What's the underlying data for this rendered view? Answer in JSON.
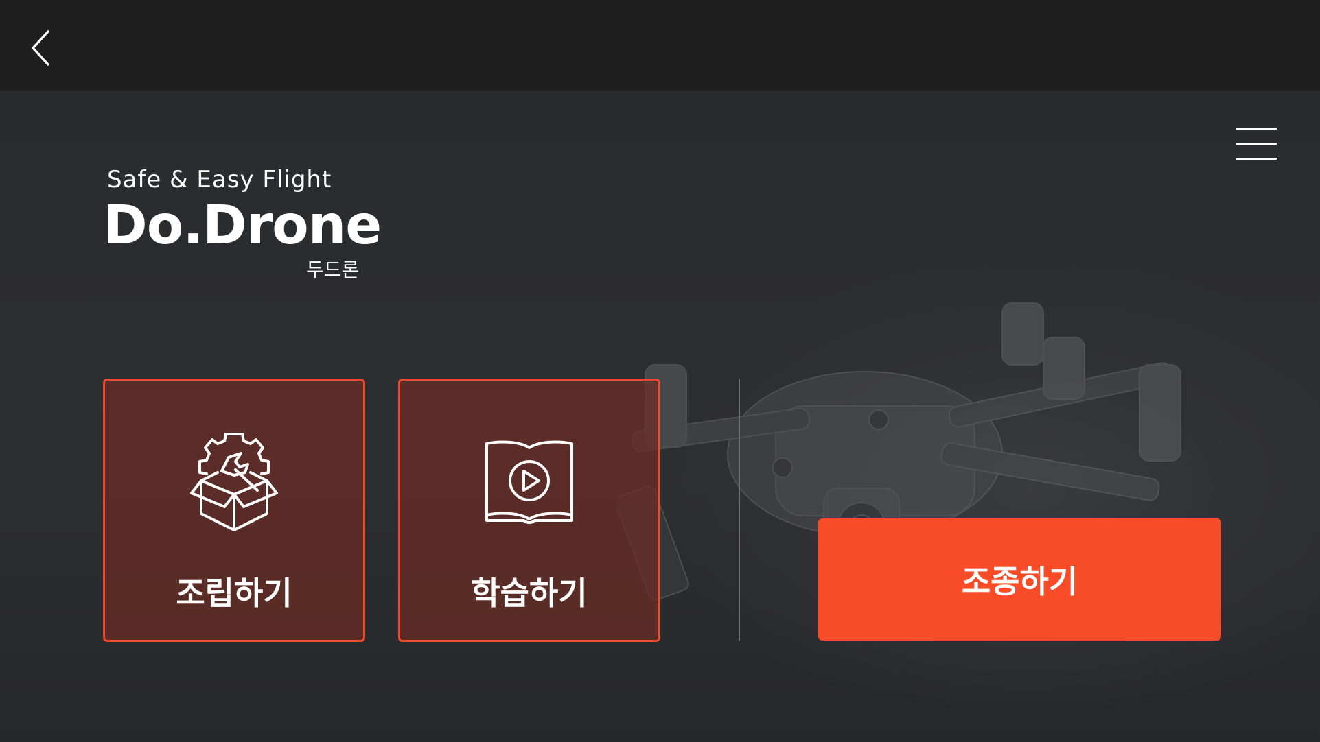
{
  "header": {
    "back_icon": "chevron-left-icon",
    "menu_icon": "hamburger-menu-icon"
  },
  "hero": {
    "tagline": "Safe & Easy Flight",
    "brand": "Do.Drone",
    "brand_korean": "두드론"
  },
  "cards": [
    {
      "label": "조립하기",
      "icon": "assembly-box-wrench-icon"
    },
    {
      "label": "학습하기",
      "icon": "video-book-icon"
    }
  ],
  "primary_action": {
    "label": "조종하기"
  },
  "colors": {
    "accent": "#f84b28",
    "card_border": "#ef4a2c",
    "card_fill": "#6e2d24",
    "topbar": "#1f1f1f",
    "background": "#2b2c30"
  }
}
